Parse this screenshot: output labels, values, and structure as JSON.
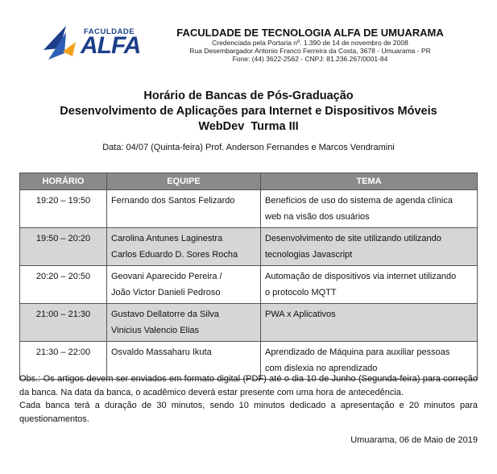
{
  "logo": {
    "top_text": "FACULDADE",
    "main_text": "ALFA",
    "brand_color": "#1d3f8a",
    "accent_color": "#f4a21a"
  },
  "institution": {
    "name": "FACULDADE DE TECNOLOGIA ALFA DE UMUARAMA",
    "line1": "Credenciada pela Portaria nº. 1.390 de 14 de novembro de 2008",
    "line2": "Rua Desembargador Antonio Franco Ferreira da Costa, 3678 - Umuarama - PR",
    "line3": "Fone: (44) 3622-2562 - CNPJ: 81.236.267/0001-84"
  },
  "titles": {
    "line1": "Horário de Bancas de Pós-Graduação",
    "line2": "Desenvolvimento de Aplicações para Internet e Dispositivos Móveis",
    "line3": "WebDev  Turma III"
  },
  "date_line": "Data: 04/07 (Quinta-feira) Prof. Anderson Fernandes e Marcos Vendramini",
  "table": {
    "headers": [
      "HORÁRIO",
      "EQUIPE",
      "TEMA"
    ],
    "rows": [
      {
        "time": "19:20 – 19:50",
        "team1": "Fernando dos Santos Felizardo",
        "team2": "",
        "tema1": "Benefícios de uso do sistema de agenda clínica",
        "tema2": "web na visão dos usuários"
      },
      {
        "time": "19:50 – 20:20",
        "team1": "Carolina Antunes Laginestra",
        "team2": "Carlos Eduardo D. Sores Rocha",
        "tema1": "Desenvolvimento de site utilizando utilizando",
        "tema2": "tecnologias Javascript"
      },
      {
        "time": "20:20 – 20:50",
        "team1": "Geovani Aparecido Pereira /",
        "team2": "João Victor Danieli Pedroso",
        "tema1": "Automação de dispositivos via internet utilizando",
        "tema2": "o protocolo MQTT"
      },
      {
        "time": "21:00 – 21:30",
        "team1": "Gustavo Dellatorre da Silva",
        "team2": "Vinicius Valencio Elias",
        "tema1": "PWA x Aplicativos",
        "tema2": ""
      },
      {
        "time": "21:30 – 22:00",
        "team1": "Osvaldo Massaharu Ikuta",
        "team2": "",
        "tema1": "Aprendizado de Máquina para auxiliar pessoas",
        "tema2": "com dislexia no aprendizado"
      }
    ]
  },
  "obs": {
    "p1": "Obs.: Os artigos devem ser enviados em formato digital (PDF) até o dia 10 de Junho (Segunda-feira) para correção da banca. Na data da banca, o acadêmico deverá estar presente com uma hora de antecedência.",
    "p2": "Cada banca terá a duração de 30 minutos, sendo 10 minutos dedicado a apresentação e 20 minutos para questionamentos."
  },
  "signature": "Umuarama, 06 de Maio de 2019"
}
